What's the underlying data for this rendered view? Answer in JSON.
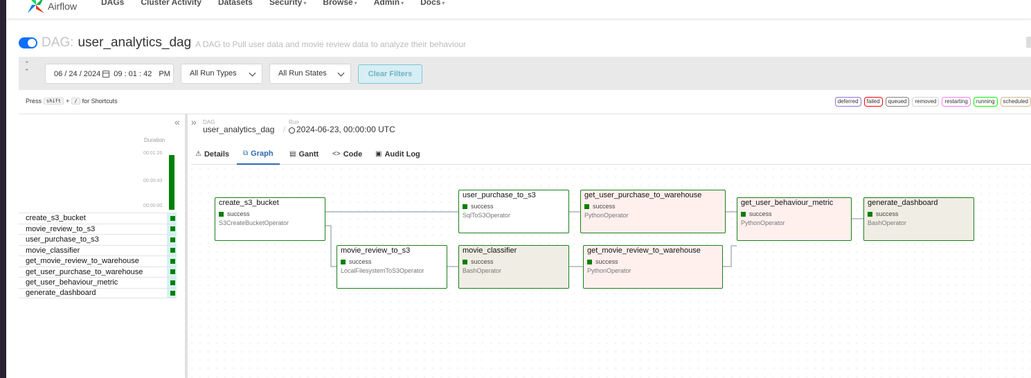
{
  "nav": {
    "brand": "Airflow",
    "items": [
      {
        "label": "DAGs",
        "caret": false
      },
      {
        "label": "Cluster Activity",
        "caret": false
      },
      {
        "label": "Datasets",
        "caret": false
      },
      {
        "label": "Security",
        "caret": true
      },
      {
        "label": "Browse",
        "caret": true
      },
      {
        "label": "Admin",
        "caret": true
      },
      {
        "label": "Docs",
        "caret": true
      }
    ]
  },
  "dag": {
    "prefix": "DAG:",
    "name": "user_analytics_dag",
    "description": "A DAG to Pull user data and movie review data to analyze their behaviour",
    "paused": false
  },
  "filters": {
    "date": "06 / 24 / 2024",
    "time": "09 : 01 : 42",
    "ampm": "PM",
    "run_type": "All Run Types",
    "run_state": "All Run States",
    "clear_label": "Clear Filters"
  },
  "shortcuts": {
    "press": "Press",
    "key1": "shift",
    "plus": "+",
    "key2": "/",
    "suffix": "for Shortcuts"
  },
  "legend": [
    {
      "label": "deferred",
      "color": "#9370db"
    },
    {
      "label": "failed",
      "color": "#ff0000"
    },
    {
      "label": "queued",
      "color": "#808080"
    },
    {
      "label": "removed",
      "color": "#d3d3d3"
    },
    {
      "label": "restarting",
      "color": "#ee82ee"
    },
    {
      "label": "running",
      "color": "#00ff00"
    },
    {
      "label": "scheduled",
      "color": "#d2b48c"
    }
  ],
  "grid": {
    "duration_label": "Duration",
    "ticks": [
      "00:01:26",
      "00:00:43",
      "00:00:00"
    ],
    "tasks": [
      "create_s3_bucket",
      "movie_review_to_s3",
      "user_purchase_to_s3",
      "movie_classifier",
      "get_movie_review_to_warehouse",
      "get_user_purchase_to_warehouse",
      "get_user_behaviour_metric",
      "generate_dashboard"
    ],
    "state_color": "#008000"
  },
  "breadcrumb": {
    "dag_label": "DAG",
    "dag": "user_analytics_dag",
    "sep": "/",
    "run_label": "Run",
    "run": "2024-06-23, 00:00:00 UTC"
  },
  "tabs": [
    {
      "label": "Details",
      "icon": "warning-icon",
      "glyph": "⚠"
    },
    {
      "label": "Graph",
      "icon": "graph-icon",
      "glyph": "⧉",
      "active": true
    },
    {
      "label": "Gantt",
      "icon": "gantt-icon",
      "glyph": "▤"
    },
    {
      "label": "Code",
      "icon": "code-icon",
      "glyph": "<>"
    },
    {
      "label": "Audit Log",
      "icon": "file-icon",
      "glyph": "▣"
    }
  ],
  "graph_nodes": [
    {
      "id": "create_s3_bucket",
      "state": "success",
      "operator": "S3CreateBucketOperator",
      "bg": "#ffffff"
    },
    {
      "id": "user_purchase_to_s3",
      "state": "success",
      "operator": "SqlToS3Operator",
      "bg": "#ffffff"
    },
    {
      "id": "movie_review_to_s3",
      "state": "success",
      "operator": "LocalFilesystemToS3Operator",
      "bg": "#ffffff"
    },
    {
      "id": "movie_classifier",
      "state": "success",
      "operator": "BashOperator",
      "bg": "#f0eee4"
    },
    {
      "id": "get_user_purchase_to_warehouse",
      "state": "success",
      "operator": "PythonOperator",
      "bg": "#fff0ee"
    },
    {
      "id": "get_movie_review_to_warehouse",
      "state": "success",
      "operator": "PythonOperator",
      "bg": "#fff0ee"
    },
    {
      "id": "get_user_behaviour_metric",
      "state": "success",
      "operator": "PythonOperator",
      "bg": "#fff0ee"
    },
    {
      "id": "generate_dashboard",
      "state": "success",
      "operator": "BashOperator",
      "bg": "#f0eee4"
    }
  ]
}
